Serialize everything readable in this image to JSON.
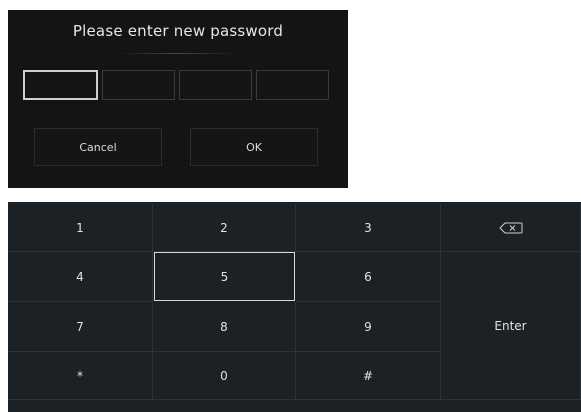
{
  "dialog": {
    "title": "Please enter new password",
    "password_slot_count": 4,
    "cancel_label": "Cancel",
    "ok_label": "OK"
  },
  "keypad": {
    "keys": [
      "1",
      "2",
      "3",
      "4",
      "5",
      "6",
      "7",
      "8",
      "9",
      "*",
      "0",
      "#"
    ],
    "selected_key": "5",
    "backspace_icon": "backspace-icon",
    "enter_label": "Enter"
  },
  "colors": {
    "dialog_bg": "#141414",
    "keypad_bg": "#1c2125",
    "selected_outline": "#d7d7d7"
  }
}
